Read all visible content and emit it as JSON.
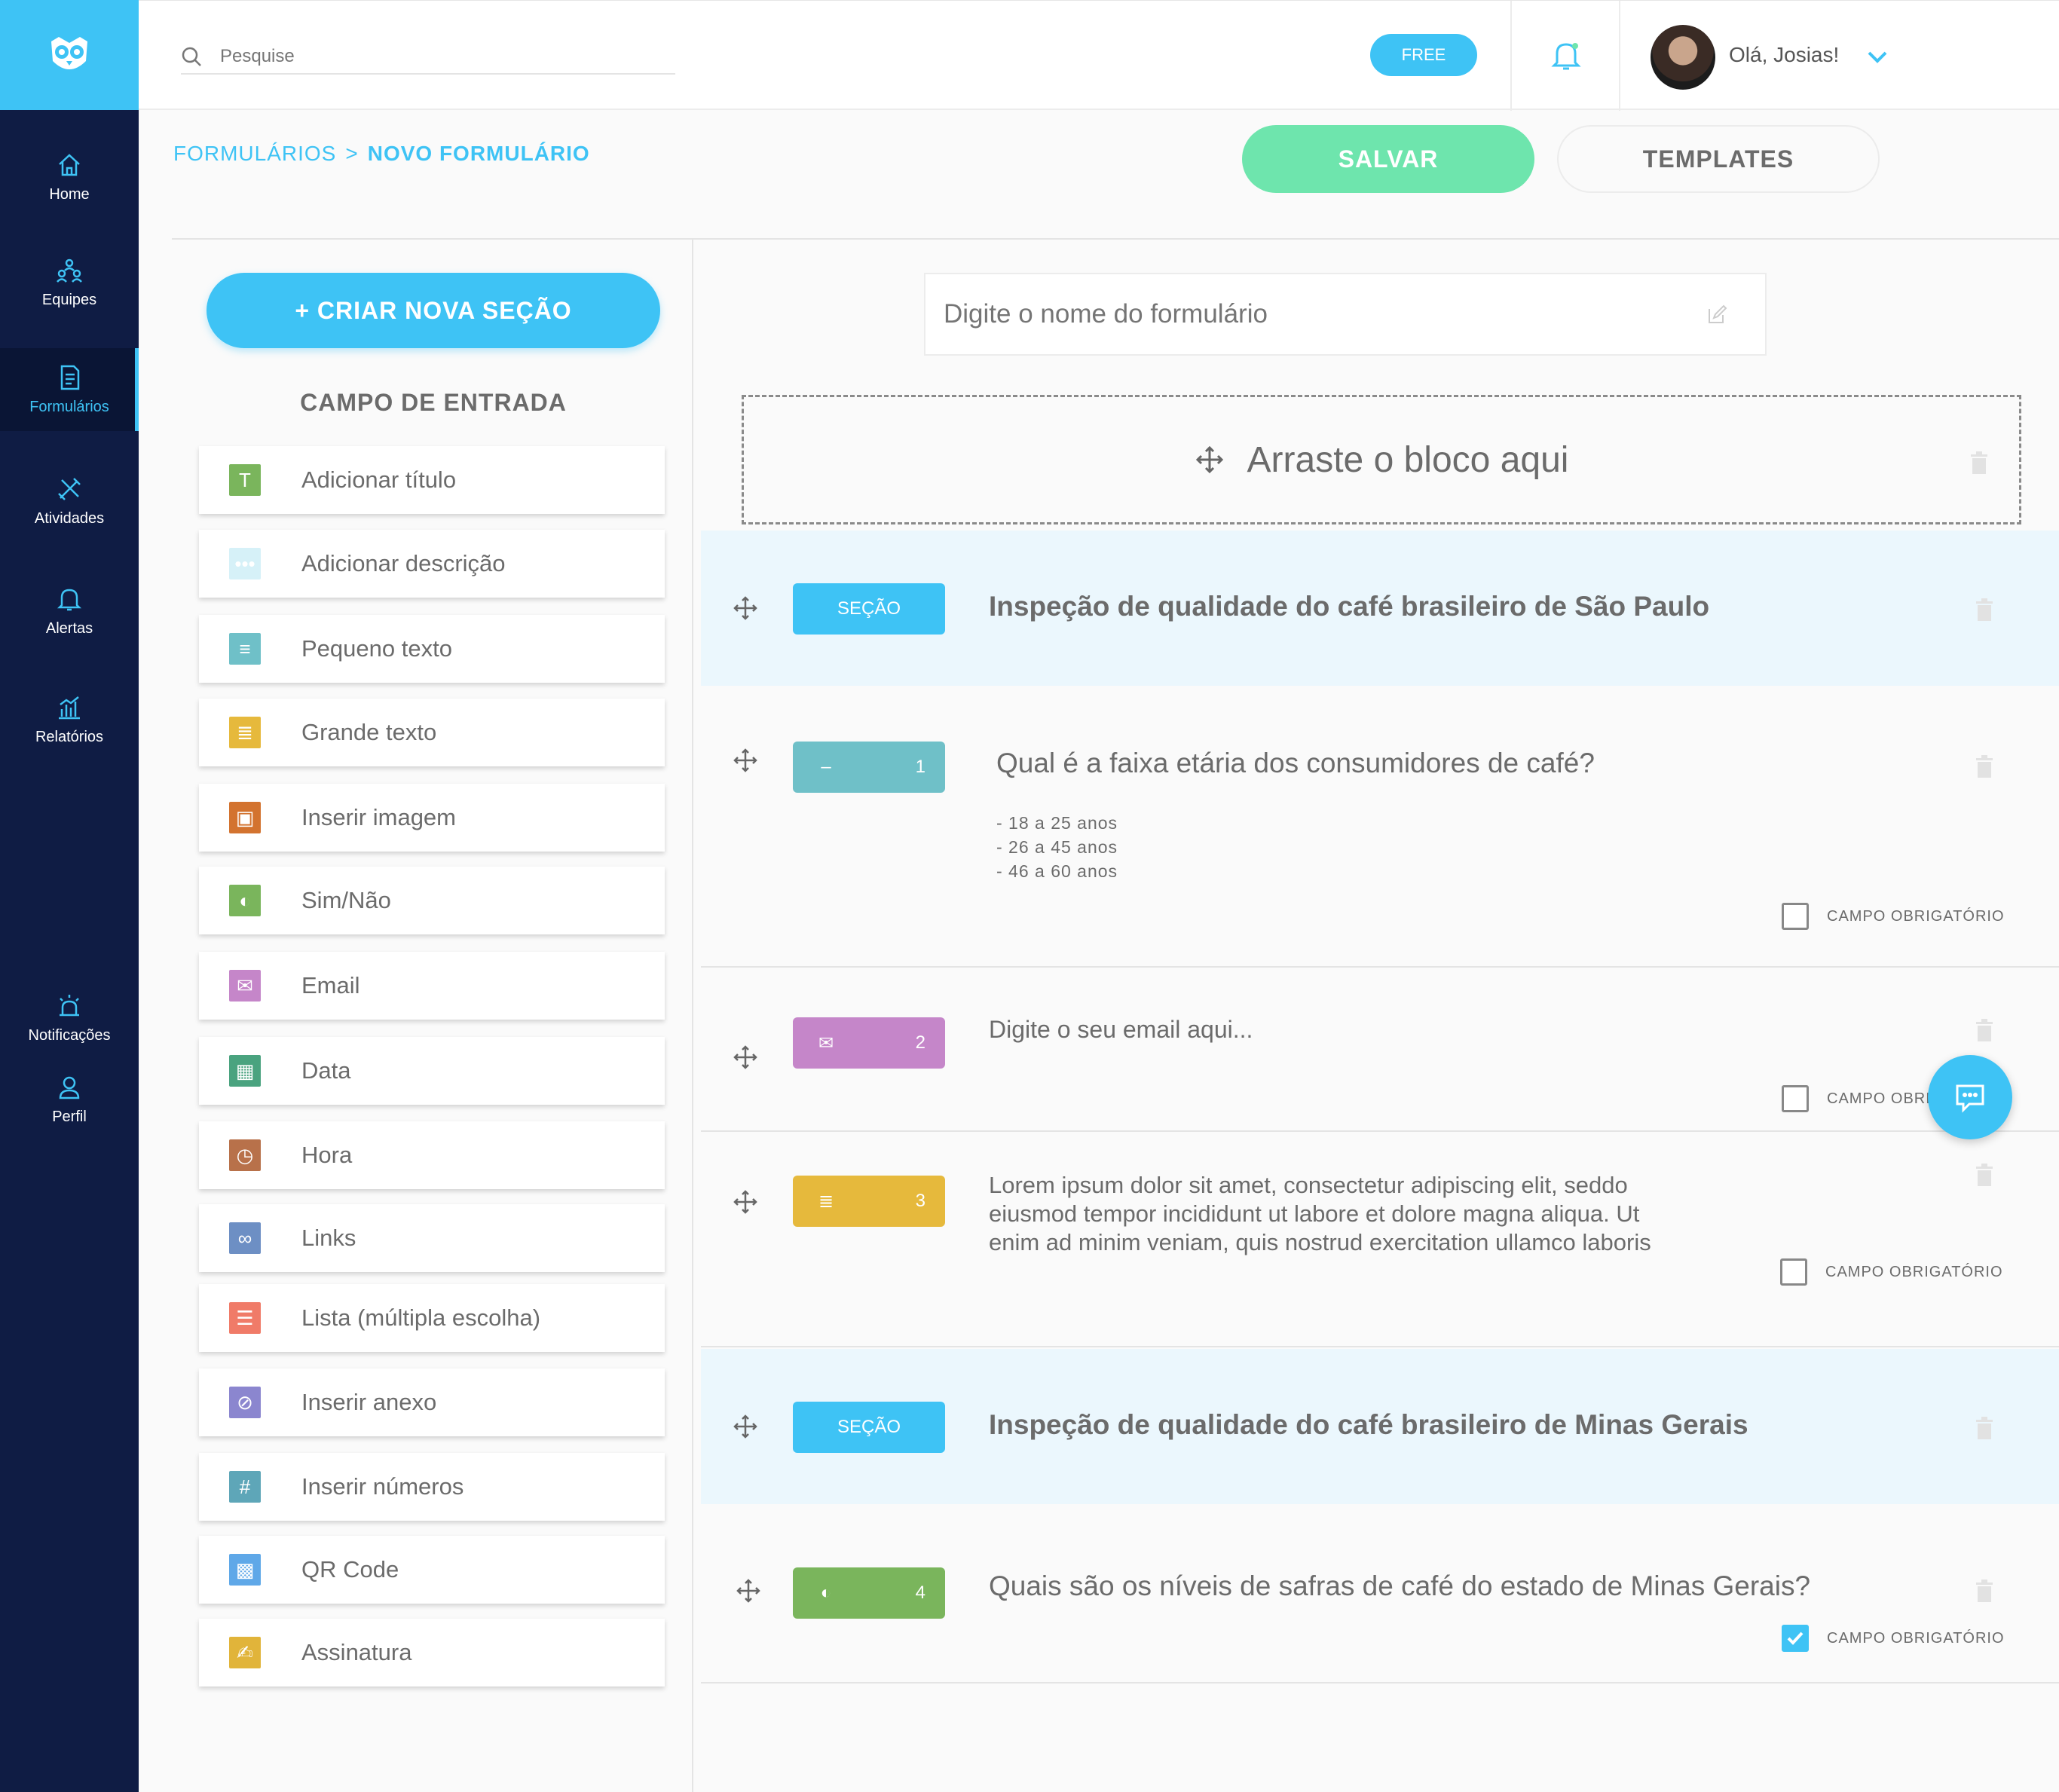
{
  "nav": {
    "items": [
      {
        "label": "Home",
        "icon": "home-icon"
      },
      {
        "label": "Equipes",
        "icon": "teams-icon"
      },
      {
        "label": "Formulários",
        "icon": "form-icon"
      },
      {
        "label": "Atividades",
        "icon": "tools-icon"
      },
      {
        "label": "Alertas",
        "icon": "bell-icon"
      },
      {
        "label": "Relatórios",
        "icon": "chart-icon"
      },
      {
        "label": "Notificações",
        "icon": "siren-icon"
      },
      {
        "label": "Perfil",
        "icon": "user-icon"
      }
    ],
    "active": "Formulários"
  },
  "header": {
    "search_placeholder": "Pesquise",
    "plan_badge": "FREE",
    "greeting": "Olá, Josias!"
  },
  "breadcrumb": {
    "root": "FORMULÁRIOS",
    "separator": ">",
    "current": "NOVO FORMULÁRIO"
  },
  "actions": {
    "save": "SALVAR",
    "templates": "TEMPLATES"
  },
  "left_panel": {
    "new_section_button": "+ CRIAR NOVA SEÇÃO",
    "title": "CAMPO DE ENTRADA",
    "fields": [
      {
        "label": "Adicionar título",
        "icon": "title-icon",
        "color": "#7ab55c",
        "glyph": "T"
      },
      {
        "label": "Adicionar descrição",
        "icon": "description-icon",
        "color": "#d6f1f8",
        "glyph": "•••"
      },
      {
        "label": "Pequeno texto",
        "icon": "short-text-icon",
        "color": "#6fc0c8",
        "glyph": "≡"
      },
      {
        "label": "Grande texto",
        "icon": "long-text-icon",
        "color": "#e6b93c",
        "glyph": "≣"
      },
      {
        "label": "Inserir imagem",
        "icon": "image-icon",
        "color": "#d3732f",
        "glyph": "▣"
      },
      {
        "label": "Sim/Não",
        "icon": "yes-no-icon",
        "color": "#7ab55c",
        "glyph": "◐"
      },
      {
        "label": "Email",
        "icon": "email-icon",
        "color": "#c586c9",
        "glyph": "✉"
      },
      {
        "label": "Data",
        "icon": "calendar-icon",
        "color": "#4aa37f",
        "glyph": "▦"
      },
      {
        "label": "Hora",
        "icon": "clock-icon",
        "color": "#b8714a",
        "glyph": "◷"
      },
      {
        "label": "Links",
        "icon": "link-icon",
        "color": "#6d8fc4",
        "glyph": "∞"
      },
      {
        "label": "Lista (múltipla escolha)",
        "icon": "list-icon",
        "color": "#f07b68",
        "glyph": "☰"
      },
      {
        "label": "Inserir anexo",
        "icon": "attachment-icon",
        "color": "#8b86cf",
        "glyph": "⊘"
      },
      {
        "label": "Inserir números",
        "icon": "hash-icon",
        "color": "#5ea6b8",
        "glyph": "#"
      },
      {
        "label": "QR Code",
        "icon": "qr-code-icon",
        "color": "#5fa8e8",
        "glyph": "▩"
      },
      {
        "label": "Assinatura",
        "icon": "signature-icon",
        "color": "#e1b43a",
        "glyph": "✍"
      }
    ]
  },
  "form": {
    "name_placeholder": "Digite o nome do formulário",
    "dropzone_text": "Arraste o bloco aqui",
    "section_tag": "SEÇÃO",
    "required_label": "CAMPO OBRIGATÓRIO",
    "blocks": [
      {
        "type": "section",
        "title": "Inspeção de qualidade do café brasileiro de São Paulo"
      },
      {
        "type": "question",
        "number": "1",
        "tag_color": "#6fc0c8",
        "tag_glyph": "–",
        "text": "Qual é a faixa etária dos consumidores de café?",
        "options": [
          "- 18 a 25 anos",
          "- 26 a 45 anos",
          "- 46 a 60 anos"
        ],
        "required": false
      },
      {
        "type": "email",
        "number": "2",
        "tag_color": "#c586c9",
        "tag_glyph": "✉",
        "placeholder": "Digite o seu email aqui...",
        "required": false,
        "required_label_visible": "CAMPO OBRIG"
      },
      {
        "type": "long_text",
        "number": "3",
        "tag_color": "#e6b93c",
        "tag_glyph": "≣",
        "text": "Lorem ipsum dolor sit amet, consectetur adipiscing elit, seddo eiusmod tempor incididunt ut labore et dolore magna aliqua. Ut enim ad minim veniam, quis nostrud exercitation ullamco laboris",
        "required": false
      },
      {
        "type": "section",
        "title": "Inspeção de qualidade do café brasileiro de Minas Gerais"
      },
      {
        "type": "yes_no",
        "number": "4",
        "tag_color": "#7ab55c",
        "tag_glyph": "◐",
        "text": "Quais são os níveis de safras de café do estado de Minas Gerais?",
        "required": true
      }
    ]
  },
  "colors": {
    "accent": "#3ec3f5",
    "save": "#6ee5ad",
    "sidebar": "#0f1c44",
    "section_bg": "#ebf7fd"
  }
}
